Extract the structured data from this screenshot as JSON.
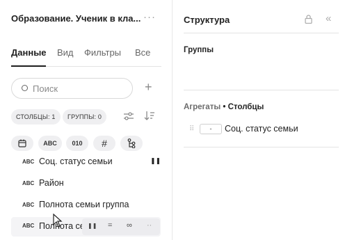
{
  "left_panel": {
    "title": "Образование. Ученик в кла...",
    "more_icon": "ellipsis-icon",
    "tabs": [
      {
        "label": "Данные",
        "active": true
      },
      {
        "label": "Вид",
        "active": false
      },
      {
        "label": "Фильтры",
        "active": false
      },
      {
        "label": "Все",
        "active": false
      }
    ],
    "search": {
      "placeholder": "Поиск",
      "value": ""
    },
    "add_icon": "plus-icon",
    "chips": [
      {
        "label": "СТОЛБЦЫ: 1"
      },
      {
        "label": "ГРУППЫ: 0"
      }
    ],
    "type_filters": [
      {
        "icon": "calendar-icon",
        "label": ""
      },
      {
        "icon": "string-type-icon",
        "label": "ABC"
      },
      {
        "icon": "boolean-type-icon",
        "label": "010"
      },
      {
        "icon": "number-type-icon",
        "label": "#"
      },
      {
        "icon": "hierarchy-icon",
        "label": ""
      }
    ],
    "fields": [
      {
        "type": "ABC",
        "label": "Соц. статус семьи"
      },
      {
        "type": "ABC",
        "label": "Район"
      },
      {
        "type": "ABC",
        "label": "Полнота семьи группа"
      },
      {
        "type": "ABC",
        "label": "Полнота семьи"
      }
    ],
    "row_actions": [
      {
        "icon": "column-icon",
        "label": "⏸"
      },
      {
        "icon": "group-icon",
        "label": "="
      },
      {
        "icon": "link-icon",
        "label": "∞"
      },
      {
        "icon": "more-icon",
        "label": "··"
      }
    ]
  },
  "right_panel": {
    "title": "Структура",
    "lock_icon": "lock-icon",
    "collapse_icon": "collapse-left-icon",
    "groups_title": "Группы",
    "aggregates_label": "Агрегаты",
    "separator": "•",
    "columns_label": "Столбцы",
    "aggregate_item": {
      "aggregation": "-",
      "field": "Соц. статус семьи"
    }
  }
}
